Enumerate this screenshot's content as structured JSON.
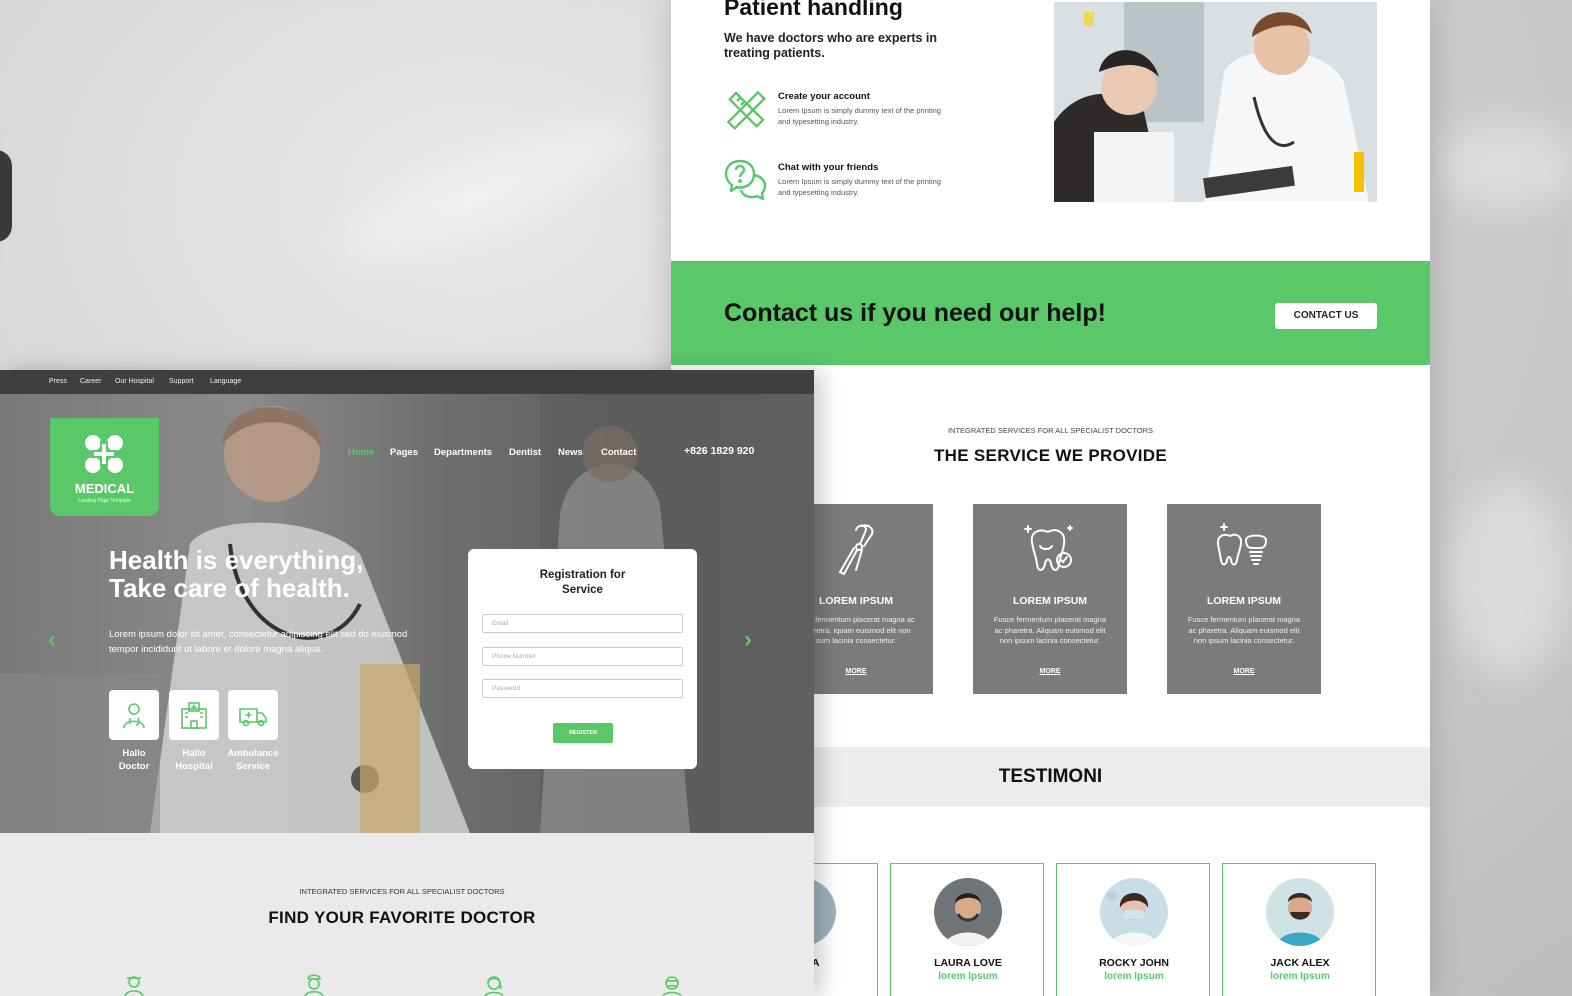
{
  "patient": {
    "title": "Patient handling",
    "subtitle": "We have doctors who are experts in treating patients.",
    "features": [
      {
        "icon": "pencil-ruler-icon",
        "title": "Create your account",
        "desc": "Lorem Ipsum is simply dummy text of the printing and typesetting industry."
      },
      {
        "icon": "chat-question-icon",
        "title": "Chat with your friends",
        "desc": "Lorem Ipsum is simply dummy text of the printing and typesetting industry."
      }
    ]
  },
  "contact_band": {
    "text": "Contact us if you need our help!",
    "button": "CONTACT US"
  },
  "services": {
    "kicker": "INTEGRATED SERVICES FOR ALL SPECIALIST DOCTORS",
    "title": "THE SERVICE WE PROVIDE",
    "cards": [
      {
        "icon": "dental-pliers-icon",
        "title": "LOREM IPSUM",
        "desc": "usce fermentum placerat magna ac pharetra. iquam euismod elit non sum lacinia consectetur.",
        "more": "MORE"
      },
      {
        "icon": "tooth-check-icon",
        "title": "LOREM IPSUM",
        "desc": "Fusce fermentum placerat magna ac pharetra. Aliquam euismod elit non ipsum lacinia consectetur.",
        "more": "MORE"
      },
      {
        "icon": "tooth-implant-icon",
        "title": "LOREM IPSUM",
        "desc": "Fusce fermentum placerat magna ac pharetra. Aliquam euismod elit non ipsum lacinia consectetur.",
        "more": "MORE"
      }
    ]
  },
  "testimoni": {
    "title": "TESTIMONI",
    "people": [
      {
        "name": "R DIVA",
        "role": "sum"
      },
      {
        "name": "LAURA LOVE",
        "role": "lorem Ipsum"
      },
      {
        "name": "ROCKY JOHN",
        "role": "lorem Ipsum"
      },
      {
        "name": "JACK ALEX",
        "role": "lorem Ipsum"
      }
    ]
  },
  "left": {
    "topbar": [
      "Press",
      "Career",
      "Our Hospital",
      "Support",
      "Language"
    ],
    "logo": {
      "title": "MEDICAL",
      "sub": "Landing Page Template"
    },
    "nav": [
      "Home",
      "Pages",
      "Departments",
      "Dentist",
      "News",
      "Contact"
    ],
    "phone": "+826 1829 920",
    "hero": {
      "line1": "Health is everything,",
      "line2": "Take care of health.",
      "para": "Lorem ipsum dolor sit amet, consectetur adipiscing elit sed do eiusmod tempor incididunt ut labore et dolore magna aliqua."
    },
    "quick": [
      {
        "icon": "doctor-icon",
        "l1": "Hallo",
        "l2": "Doctor"
      },
      {
        "icon": "hospital-icon",
        "l1": "Hallo",
        "l2": "Hospital"
      },
      {
        "icon": "ambulance-icon",
        "l1": "Ambulance",
        "l2": "Service"
      }
    ],
    "register": {
      "title1": "Registration for",
      "title2": "Service",
      "email_ph": "Email",
      "phone_ph": "Phone Number",
      "password_ph": "Password",
      "button": "REGISTER"
    },
    "find": {
      "kicker": "INTEGRATED SERVICES FOR ALL SPECIALIST DOCTORS",
      "title": "FIND YOUR FAVORITE DOCTOR"
    }
  },
  "colors": {
    "accent": "#5ac769",
    "card_gray": "#7b7b7b",
    "topbar": "#3f3f3f"
  }
}
